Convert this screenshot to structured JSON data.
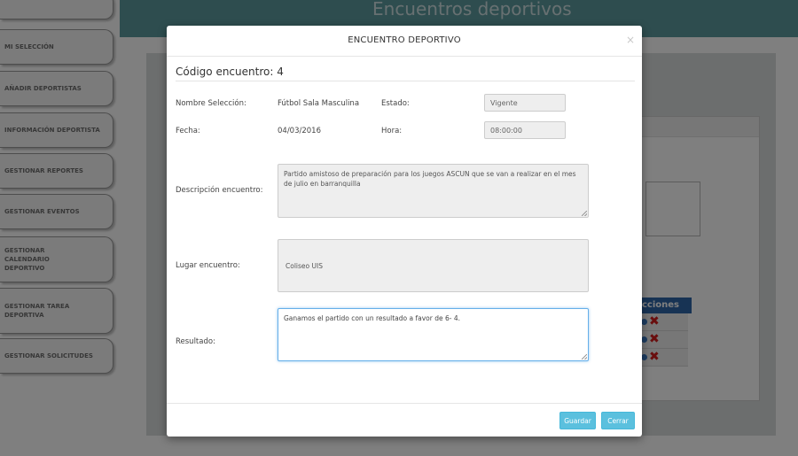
{
  "page": {
    "title": "Encuentros deportivos"
  },
  "sidebar": {
    "items": [
      {
        "label": ""
      },
      {
        "label": "MI SELECCIÓN"
      },
      {
        "label": "AÑADIR DEPORTISTAS"
      },
      {
        "label": "INFORMACIÓN DEPORTISTA"
      },
      {
        "label": "GESTIONAR REPORTES"
      },
      {
        "label": "GESTIONAR EVENTOS"
      },
      {
        "label": "GESTIONAR CALENDARIO DEPORTIVO"
      },
      {
        "label": "GESTIONAR TAREA DEPORTIVA"
      },
      {
        "label": "GESTIONAR SOLICITUDES"
      }
    ]
  },
  "background_table": {
    "header": "cciones"
  },
  "modal": {
    "title": "ENCUENTRO DEPORTIVO",
    "close_glyph": "×",
    "code_label": "Código encuentro: 4",
    "fields": {
      "seleccion_label": "Nombre Selección:",
      "seleccion_value": "Fútbol Sala Masculina",
      "estado_label": "Estado:",
      "estado_value": "Vigente",
      "fecha_label": "Fecha:",
      "fecha_value": "04/03/2016",
      "hora_label": "Hora:",
      "hora_value": "08:00:00",
      "descripcion_label": "Descripción encuentro:",
      "descripcion_value": "Partido amistoso de preparación para los juegos ASCUN que se van a realizar en el mes de julio en barranquilla",
      "lugar_label": "Lugar encuentro:",
      "lugar_value": "Coliseo UIS",
      "resultado_label": "Resultado:",
      "resultado_value": "Ganamos el partido con un resultado a favor de 6- 4."
    },
    "buttons": {
      "save_label": "Guardar",
      "close_label": "Cerrar"
    }
  },
  "colors": {
    "topbar": "#5c9a9f",
    "button": "#5bc0de",
    "table_header": "#2f67a8",
    "delete_icon": "#d21d1d"
  }
}
